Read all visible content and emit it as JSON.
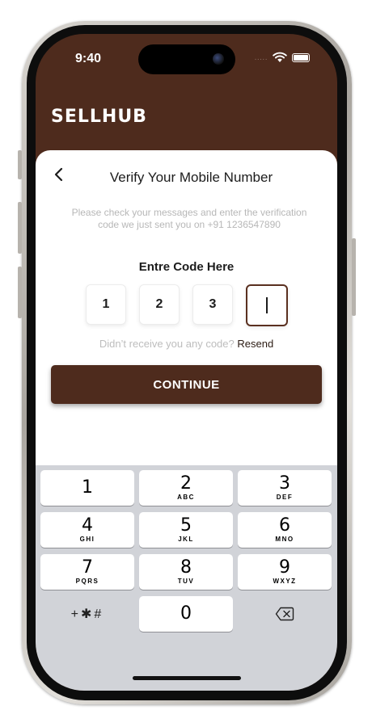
{
  "status_bar": {
    "time": "9:40",
    "signal": "....."
  },
  "app": {
    "brand": "SELLHUB"
  },
  "verify": {
    "title": "Verify Your Mobile Number",
    "description": "Please check your messages and enter the verification code we just sent you on +91 1236547890",
    "code_label": "Entre Code Here",
    "digits": [
      "1",
      "2",
      "3",
      ""
    ],
    "resend_prompt": "Didn’t receive you any code?",
    "resend_link": "Resend",
    "continue_label": "CONTINUE"
  },
  "keyboard": {
    "keys": [
      {
        "num": "1",
        "letters": ""
      },
      {
        "num": "2",
        "letters": "ABC"
      },
      {
        "num": "3",
        "letters": "DEF"
      },
      {
        "num": "4",
        "letters": "GHI"
      },
      {
        "num": "5",
        "letters": "JKL"
      },
      {
        "num": "6",
        "letters": "MNO"
      },
      {
        "num": "7",
        "letters": "PQRS"
      },
      {
        "num": "8",
        "letters": "TUV"
      },
      {
        "num": "9",
        "letters": "WXYZ"
      },
      {
        "num": "0",
        "letters": ""
      }
    ],
    "symbols": "+✱#"
  },
  "colors": {
    "brand": "#4e2b1d",
    "accent_text": "#2a1a12",
    "muted_text": "#b7b7b7"
  }
}
